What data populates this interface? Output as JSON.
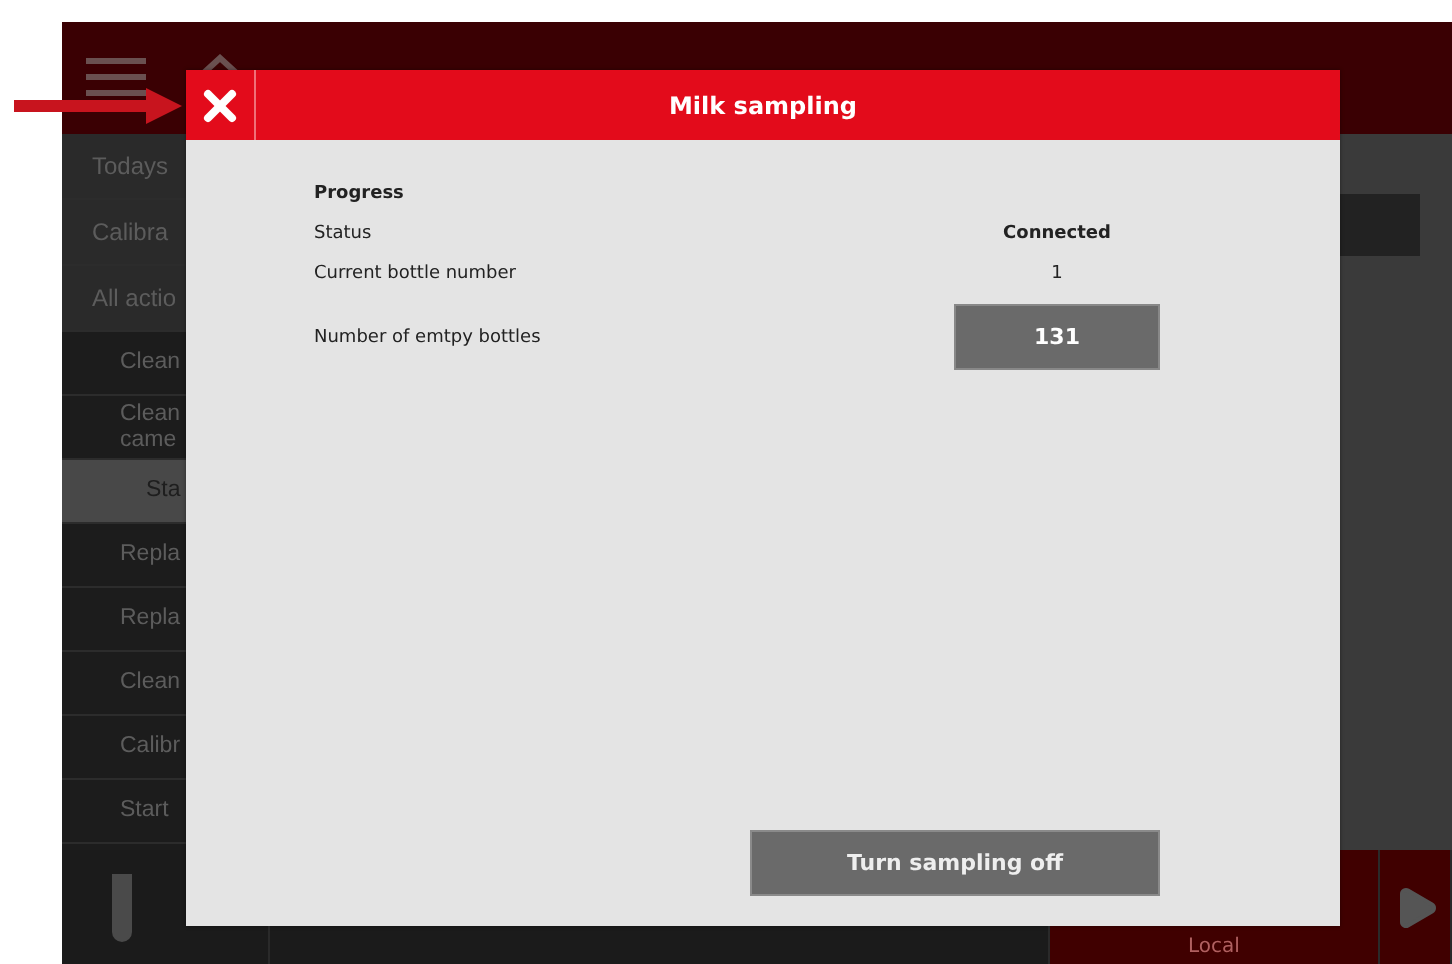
{
  "app": {
    "sidebar": {
      "items": [
        {
          "label": "Todays",
          "selected": false
        },
        {
          "label": "Calibra",
          "selected": false
        },
        {
          "label": "All actio",
          "selected": false,
          "children": [
            {
              "label": "Clean",
              "selected": false
            },
            {
              "label": "Clean came",
              "selected": false
            },
            {
              "label": "Sta",
              "selected": true
            },
            {
              "label": "Repla",
              "selected": false
            },
            {
              "label": "Repla",
              "selected": false
            },
            {
              "label": "Clean",
              "selected": false
            },
            {
              "label": "Calibr",
              "selected": false
            },
            {
              "label": "Start",
              "selected": false
            }
          ]
        }
      ]
    },
    "status_bar": {
      "location": "Local"
    }
  },
  "dialog": {
    "title": "Milk sampling",
    "section": "Progress",
    "fields": [
      {
        "label": "Status",
        "value": "Connected",
        "kind": "text"
      },
      {
        "label": "Current bottle number",
        "value": "1",
        "kind": "text"
      },
      {
        "label": "Number of emtpy bottles",
        "value": "131",
        "kind": "box"
      }
    ],
    "action": "Turn sampling off"
  }
}
